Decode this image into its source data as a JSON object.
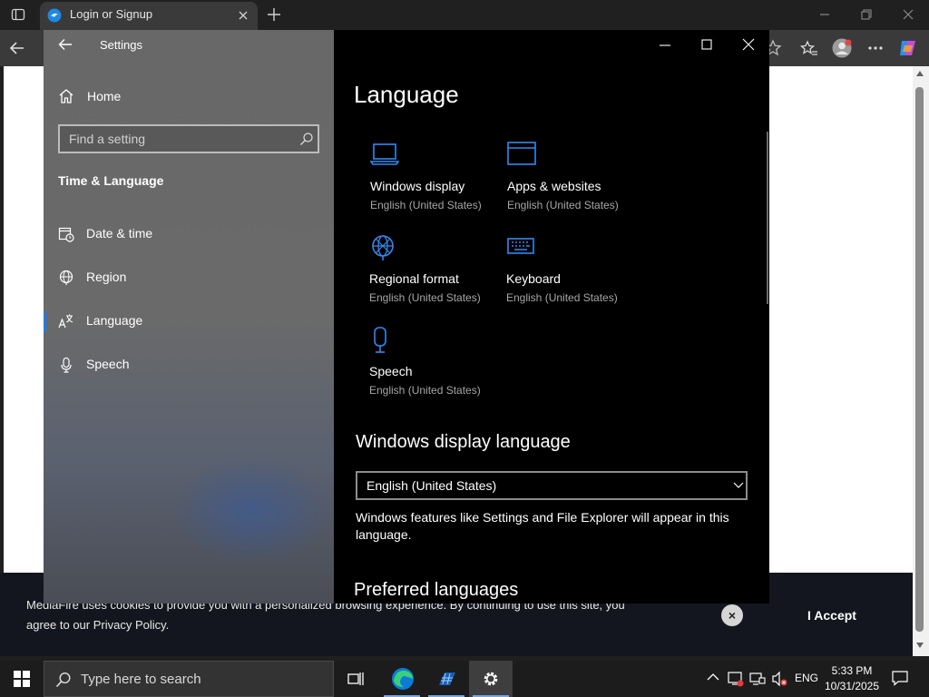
{
  "browser": {
    "tab_title": "Login or Signup",
    "colors": {
      "accent": "#1f7ce8"
    }
  },
  "cookie_bar": {
    "text_line1": "MediaFire uses cookies to provide you with a personalized browsing experience. By continuing to use this site, you",
    "text_line2_prefix": "agree to our ",
    "policy_link": "Privacy Policy",
    "text_line2_suffix": ".",
    "close_label": "×",
    "accept_label": "I Accept"
  },
  "settings": {
    "app_title": "Settings",
    "home_label": "Home",
    "search_placeholder": "Find a setting",
    "section_title": "Time & Language",
    "nav": [
      {
        "label": "Date & time",
        "icon": "calendar-clock-icon"
      },
      {
        "label": "Region",
        "icon": "globe-icon"
      },
      {
        "label": "Language",
        "icon": "language-icon",
        "active": true
      },
      {
        "label": "Speech",
        "icon": "microphone-icon"
      }
    ],
    "page_title": "Language",
    "tiles": [
      {
        "title": "Windows display",
        "subtitle": "English (United States)",
        "icon": "laptop-icon"
      },
      {
        "title": "Apps & websites",
        "subtitle": "English (United States)",
        "icon": "window-icon"
      },
      {
        "title": "Regional format",
        "subtitle": "English (United States)",
        "icon": "globe-format-icon"
      },
      {
        "title": "Keyboard",
        "subtitle": "English (United States)",
        "icon": "keyboard-icon"
      },
      {
        "title": "Speech",
        "subtitle": "English (United States)",
        "icon": "microphone-icon"
      }
    ],
    "display_language_heading": "Windows display language",
    "display_language_value": "English (United States)",
    "display_language_desc_line1": "Windows features like Settings and File Explorer will appear in this",
    "display_language_desc_line2": "language.",
    "preferred_heading": "Preferred languages"
  },
  "taskbar": {
    "search_text": "Type here to search",
    "language": "ENG",
    "time": "5:33 PM",
    "date": "10/31/2025"
  }
}
